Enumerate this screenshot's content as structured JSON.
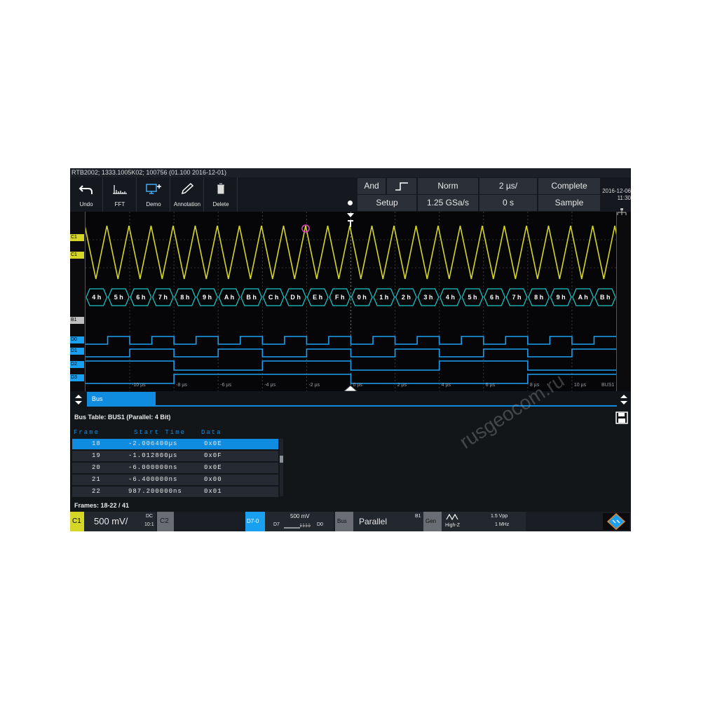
{
  "title_bar": "RTB2002; 1333.1005K02; 100756 (01.100 2016-12-01)",
  "toolbar": {
    "tools": [
      {
        "label": "Undo",
        "icon": "undo-icon"
      },
      {
        "label": "FFT",
        "icon": "fft-icon"
      },
      {
        "label": "Demo",
        "icon": "demo-icon"
      },
      {
        "label": "Annotation",
        "icon": "pencil-icon"
      },
      {
        "label": "Delete",
        "icon": "trash-icon"
      }
    ]
  },
  "trigger": {
    "logic": "And",
    "edge_icon": "rising-edge-icon",
    "setup": "Setup",
    "mode": "Norm",
    "sample_rate": "1.25 GSa/s",
    "time_div": "2 µs/",
    "offset": "0 s",
    "status": "Complete",
    "acquisition": "Sample",
    "date": "2016-12-06",
    "time": "11:30"
  },
  "waveforms": {
    "channel_labels": [
      "C1",
      "C1",
      "B1",
      "D0",
      "D1",
      "D2",
      "D3"
    ],
    "bus_values": [
      "4 h",
      "5 h",
      "6 h",
      "7 h",
      "8 h",
      "9 h",
      "A h",
      "B h",
      "C h",
      "D h",
      "E h",
      "F h",
      "0 h",
      "1 h",
      "2 h",
      "3 h",
      "4 h",
      "5 h",
      "6 h",
      "7 h",
      "8 h",
      "9 h",
      "A h",
      "B h"
    ],
    "time_ticks": [
      "-10 µs",
      "-8 µs",
      "-6 µs",
      "-4 µs",
      "-2 µs",
      "0 µs",
      "2 µs",
      "4 µs",
      "6 µs",
      "8 µs",
      "10 µs"
    ],
    "bus_tag": "BUS1",
    "colors": {
      "analog": "#d6d629",
      "bus": "#1ec8c8",
      "digital": "#1aa0f0"
    }
  },
  "bus_tab": {
    "label": "Bus"
  },
  "bus_table": {
    "title": "Bus Table: BUS1 (Parallel: 4 Bit)",
    "headers": {
      "frame": "Frame",
      "start_time": "Start Time",
      "data": "Data"
    },
    "rows": [
      {
        "frame": "18",
        "start": "-2.006400µs",
        "data": "0x0E",
        "selected": true
      },
      {
        "frame": "19",
        "start": "-1.012800µs",
        "data": "0x0F",
        "selected": false
      },
      {
        "frame": "20",
        "start": "-6.000000ns",
        "data": "0x0E",
        "selected": false
      },
      {
        "frame": "21",
        "start": "-6.400000ns",
        "data": "0x00",
        "selected": false
      },
      {
        "frame": "22",
        "start": "987.200000ns",
        "data": "0x01",
        "selected": false
      }
    ],
    "frames_summary": "Frames: 18-22 / 41"
  },
  "status_bar": {
    "c1": {
      "name": "C1",
      "scale": "500 mV/",
      "coupling": "DC",
      "probe": "10:1"
    },
    "c2": {
      "name": "C2"
    },
    "digital": {
      "name": "D7-0",
      "threshold": "500 mV",
      "left": "D7",
      "right": "D0"
    },
    "bus": {
      "name": "Bus",
      "type": "Parallel",
      "id": "B1"
    },
    "gen": {
      "name": "Gen",
      "impedance": "High-Z",
      "amplitude": "1.5 Vpp",
      "frequency": "1 MHz"
    },
    "logo_icon": "rohde-schwarz-logo-icon"
  },
  "watermark": "rusgeocom.ru"
}
